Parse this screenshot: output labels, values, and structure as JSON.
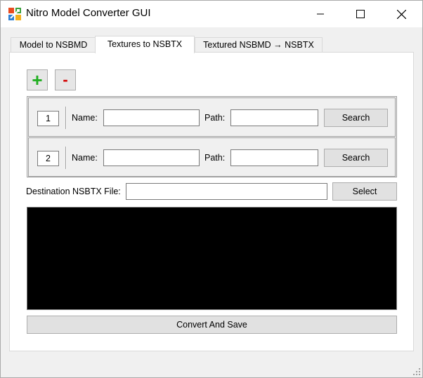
{
  "window": {
    "title": "Nitro Model Converter GUI",
    "accent_color": "#ffffff"
  },
  "tabs": [
    {
      "label": "Model to NSBMD",
      "active": false
    },
    {
      "label": "Textures to NSBTX",
      "active": true
    },
    {
      "label": "Textured NSBMD → NSBTX",
      "active": false
    }
  ],
  "toolbar": {
    "add_label": "+",
    "remove_label": "-",
    "add_color": "#1fae1f",
    "remove_color": "#d40000"
  },
  "texture_rows": [
    {
      "index": "1",
      "name_label": "Name:",
      "name_value": "",
      "path_label": "Path:",
      "path_value": "",
      "search_label": "Search"
    },
    {
      "index": "2",
      "name_label": "Name:",
      "name_value": "",
      "path_label": "Path:",
      "path_value": "",
      "search_label": "Search"
    }
  ],
  "destination": {
    "label": "Destination NSBTX File:",
    "value": "",
    "select_label": "Select"
  },
  "console": {
    "text": "",
    "background": "#000000"
  },
  "convert_button": {
    "label": "Convert And Save"
  }
}
